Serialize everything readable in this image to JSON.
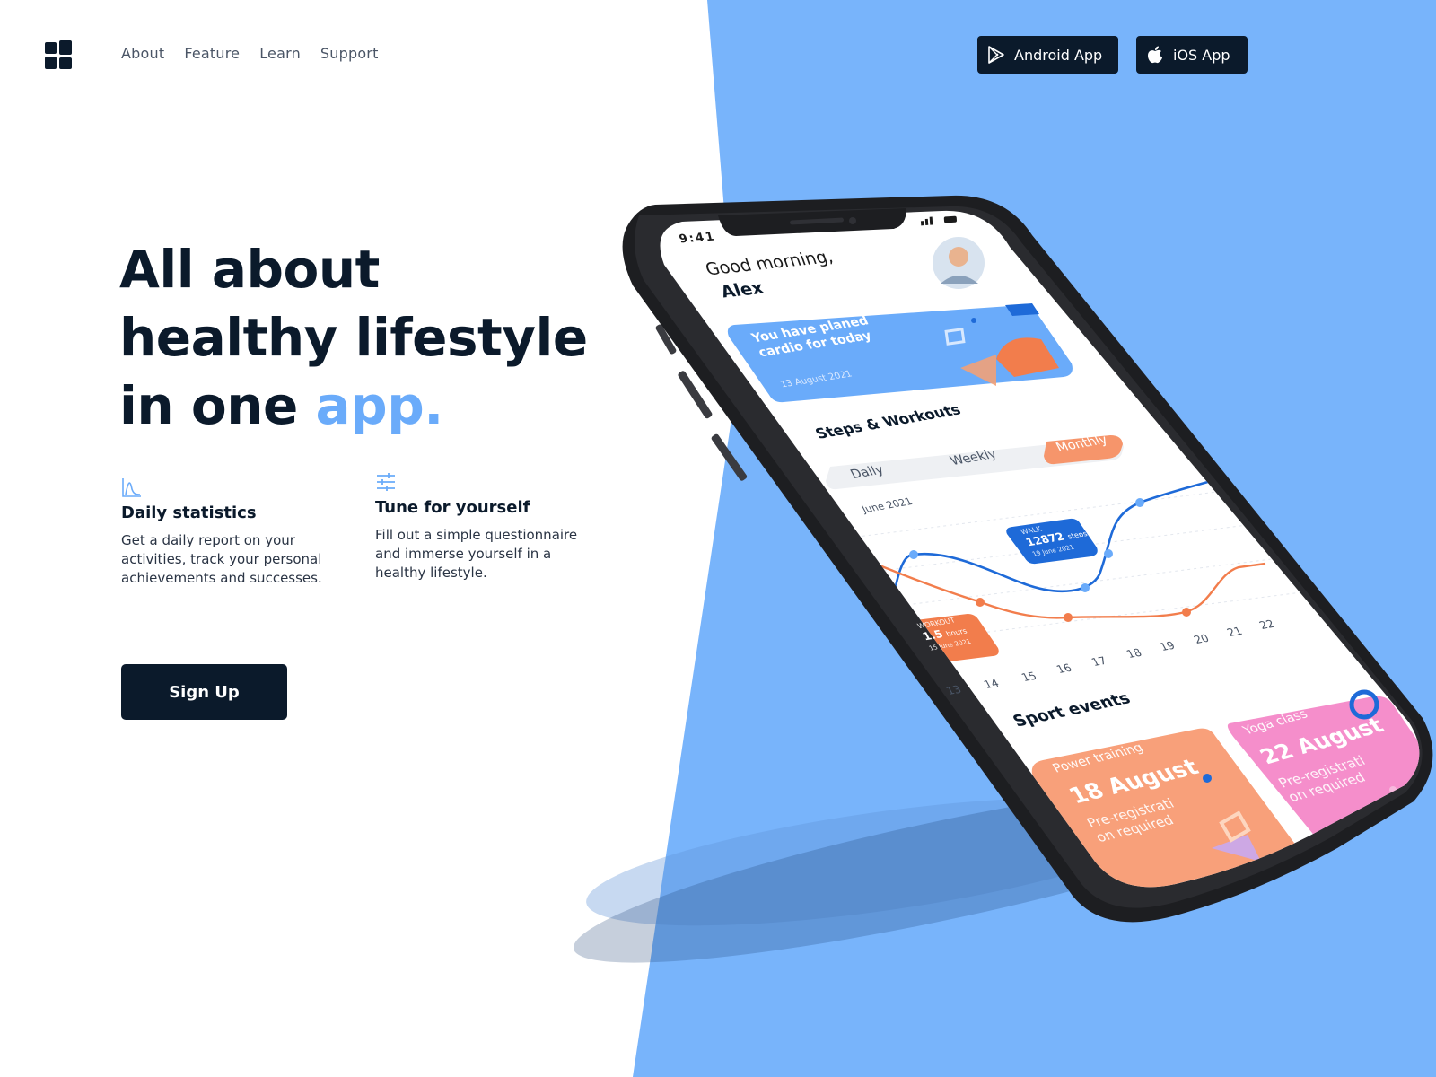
{
  "nav": {
    "items": [
      "About",
      "Feature",
      "Learn",
      "Support"
    ]
  },
  "stores": {
    "android": "Android App",
    "ios": "iOS App"
  },
  "hero": {
    "line1": "All about",
    "line2": "healthy lifestyle",
    "line3_prefix": "in one ",
    "line3_accent": "app."
  },
  "features": [
    {
      "icon": "chart-icon",
      "title": "Daily statistics",
      "text": "Get a daily report on your activities, track your personal achievements and successes."
    },
    {
      "icon": "sliders-icon",
      "title": "Tune for yourself",
      "text": "Fill out a simple questionnaire and immerse yourself in a healthy lifestyle."
    }
  ],
  "cta": {
    "signup": "Sign Up"
  },
  "phone_screen": {
    "time": "9:41",
    "greeting": "Good morning,",
    "name": "Alex",
    "banner_text_1": "You have planed",
    "banner_text_2": "cardio for today",
    "banner_date": "13 August 2021",
    "section_steps": "Steps & Workouts",
    "tabs": [
      "Daily",
      "Weekly",
      "Monthly"
    ],
    "active_tab": "Monthly",
    "month": "June 2021",
    "walk": {
      "label": "WALK",
      "value": "12872",
      "unit": "steps",
      "date": "19 June 2021"
    },
    "workout": {
      "label": "WORKOUT",
      "value": "1.5",
      "unit": "hours",
      "date": "15 June 2021"
    },
    "days": [
      "13",
      "14",
      "15",
      "16",
      "17",
      "18",
      "19",
      "20",
      "21",
      "22"
    ],
    "section_events": "Sport events",
    "events": [
      {
        "title": "Power training",
        "date": "18 August",
        "note_1": "Pre-registrati",
        "note_2": "on required"
      },
      {
        "title": "Yoga class",
        "date": "22 August",
        "note_1": "Pre-registrati",
        "note_2": "on required"
      }
    ]
  },
  "colors": {
    "accent": "#6aabfa",
    "dark": "#0b1a2b",
    "blue_bg": "#78b4fb",
    "orange": "#f27d4c",
    "pink": "#f58ecb"
  }
}
